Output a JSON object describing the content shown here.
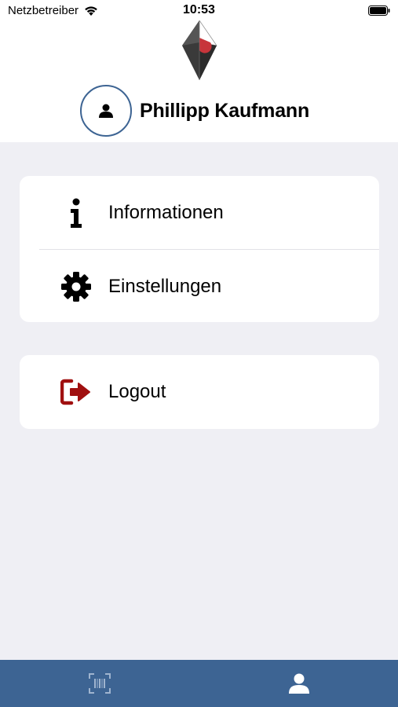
{
  "status_bar": {
    "carrier": "Netzbetreiber",
    "time": "10:53"
  },
  "profile": {
    "name": "Phillipp Kaufmann"
  },
  "menu": {
    "items": [
      {
        "label": "Informationen",
        "icon": "info-icon"
      },
      {
        "label": "Einstellungen",
        "icon": "gear-icon"
      }
    ]
  },
  "logout": {
    "label": "Logout",
    "icon": "logout-icon",
    "icon_color": "#a01010"
  },
  "tabbar": {
    "tabs": [
      {
        "icon": "barcode-scan-icon",
        "active": false
      },
      {
        "icon": "user-icon",
        "active": true
      }
    ],
    "background": "#3d6493"
  },
  "colors": {
    "accent": "#3d6493",
    "background": "#efeff4"
  }
}
